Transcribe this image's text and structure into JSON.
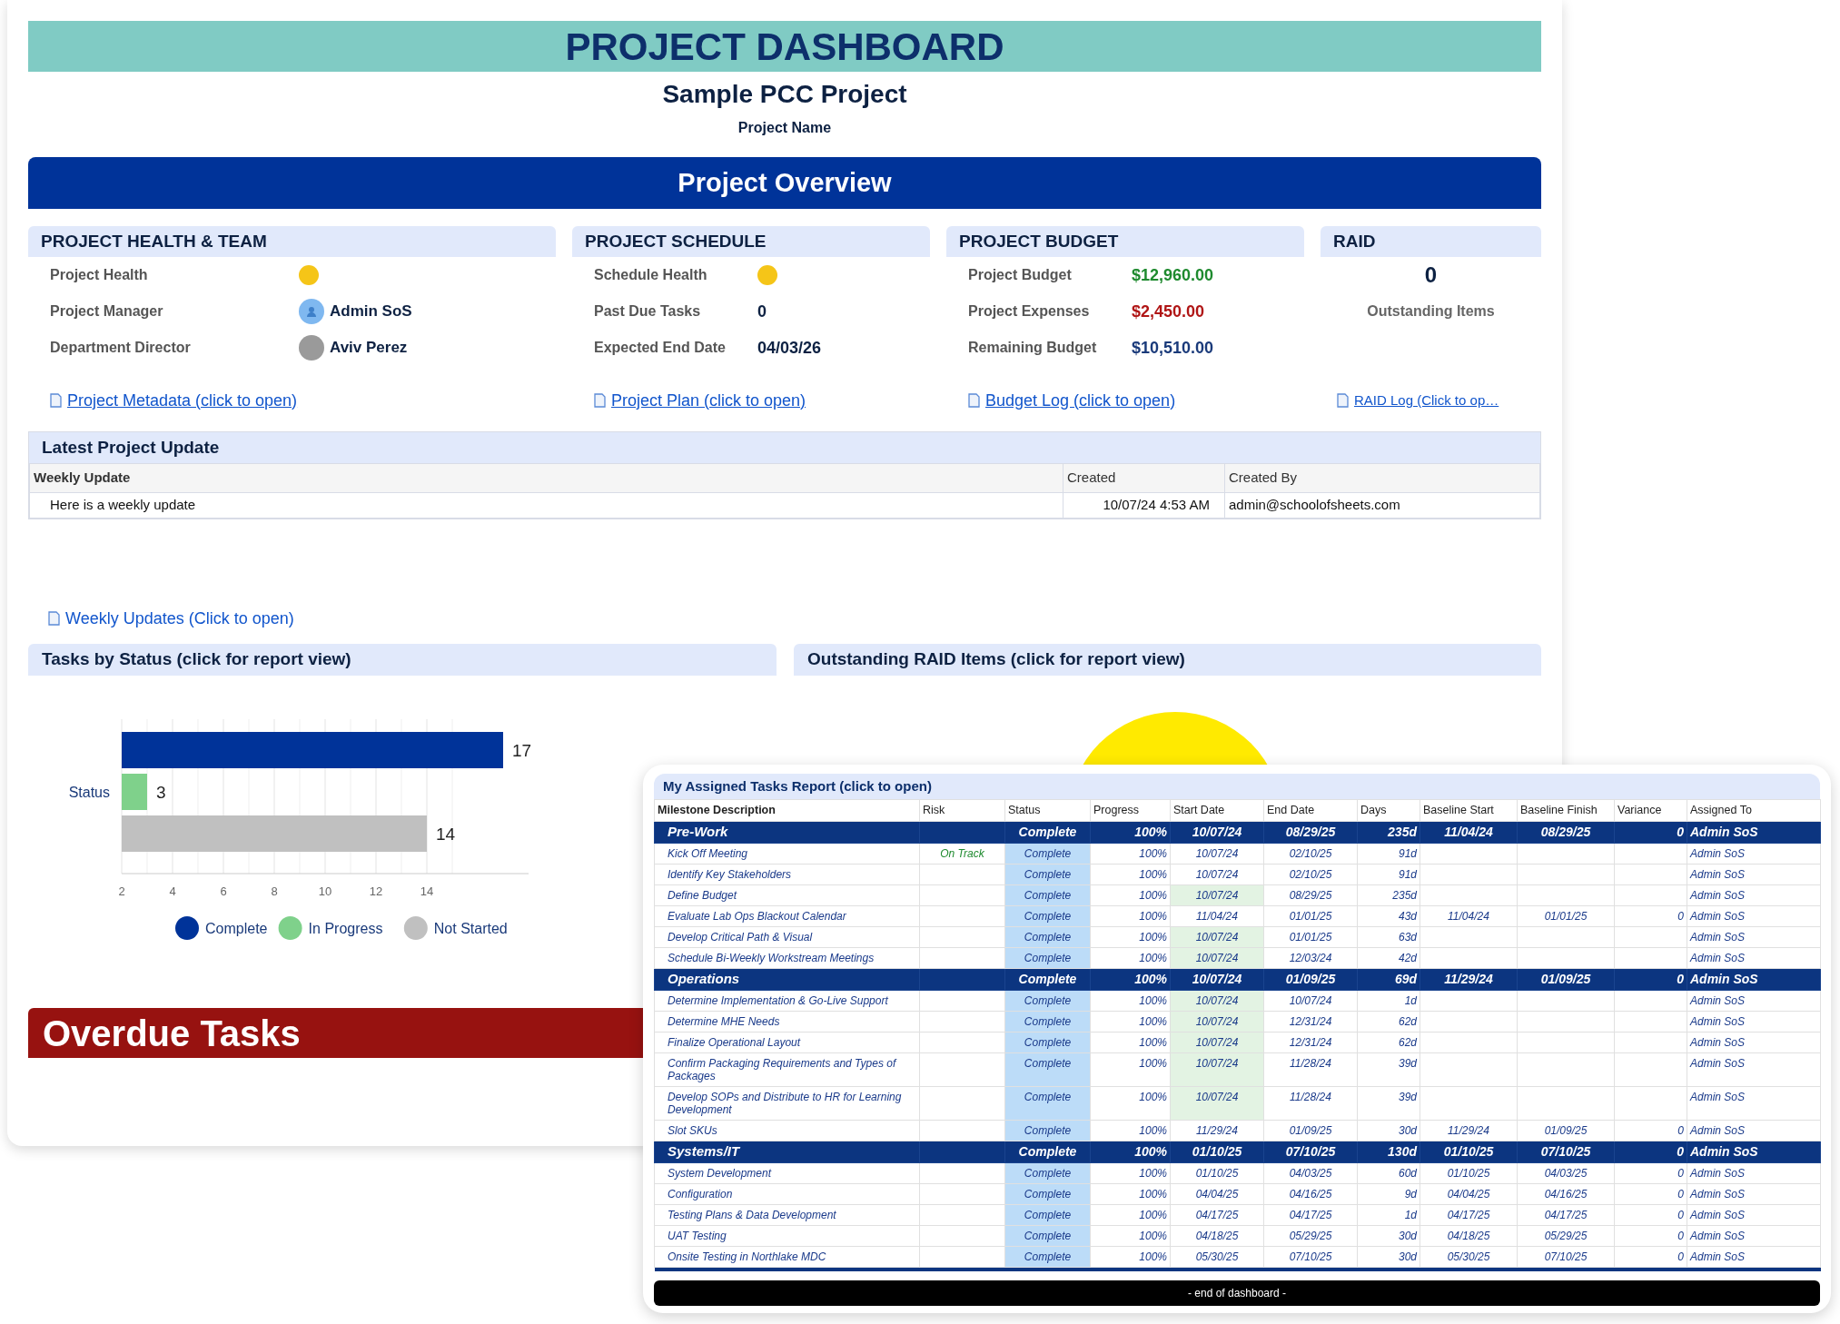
{
  "header": {
    "title": "PROJECT DASHBOARD",
    "project": "Sample PCC Project",
    "project_label": "Project Name"
  },
  "overview_title": "Project Overview",
  "sections": [
    {
      "title": "PROJECT HEALTH & TEAM",
      "rows": [
        {
          "kind": "status",
          "label": "Project Health",
          "color": "#f5c518"
        },
        {
          "kind": "avatar",
          "label": "Project Manager",
          "value": "Admin SoS"
        },
        {
          "kind": "photo",
          "label": "Department Director",
          "value": "Aviv Perez"
        }
      ]
    },
    {
      "title": "PROJECT SCHEDULE",
      "rows": [
        {
          "kind": "status",
          "label": "Schedule Health",
          "color": "#f5c518"
        },
        {
          "kind": "value",
          "label": "Past Due Tasks",
          "value": "0"
        },
        {
          "kind": "value",
          "label": "Expected End Date",
          "value": "04/03/26"
        }
      ]
    },
    {
      "title": "PROJECT BUDGET",
      "rows": [
        {
          "kind": "money",
          "label": "Project Budget",
          "value": "$12,960.00",
          "color": "#1e8a2e"
        },
        {
          "kind": "money",
          "label": "Project Expenses",
          "value": "$2,450.00",
          "color": "#b01515"
        },
        {
          "kind": "money",
          "label": "Remaining Budget",
          "value": "$10,510.00",
          "color": "#1a3a7a"
        }
      ]
    },
    {
      "title": "RAID",
      "rows": [
        {
          "kind": "count",
          "value": "0",
          "label": "Outstanding Items"
        }
      ]
    }
  ],
  "links": [
    {
      "label": "Project Metadata (click to open)",
      "compact": false
    },
    {
      "label": "Project Plan (click to open)",
      "compact": false
    },
    {
      "label": "Budget Log (click to open)",
      "compact": false
    },
    {
      "label": "RAID Log (Click to op…",
      "compact": true
    }
  ],
  "update": {
    "title": "Latest Project Update",
    "columns": [
      "Weekly Update",
      "Created",
      "Created By"
    ],
    "rows": [
      [
        "Here is a weekly update",
        "10/07/24 4:53 AM",
        "admin@schoolofsheets.com"
      ]
    ]
  },
  "weekly_link": "Weekly Updates (Click to open)",
  "tasks_by_status": {
    "title": "Tasks by Status (click for report view)",
    "chart_data": {
      "type": "bar",
      "orientation": "horizontal",
      "categories": [
        "Status"
      ],
      "series": [
        {
          "name": "Complete",
          "color": "#003399",
          "values": [
            17
          ]
        },
        {
          "name": "In Progress",
          "color": "#7fd18b",
          "values": [
            3
          ]
        },
        {
          "name": "Not Started",
          "color": "#c0c0c0",
          "values": [
            14
          ]
        }
      ],
      "xlim": [
        2,
        18
      ],
      "legend": "bottom",
      "xticks": [
        2,
        4,
        6,
        8,
        10,
        12,
        14
      ],
      "grid": true,
      "data_labels": true
    }
  },
  "raid_items": {
    "title": "Outstanding RAID Items (click for report view)"
  },
  "overdue_title": "Overdue Tasks",
  "report": {
    "title": "My Assigned Tasks Report (click to open)",
    "columns": [
      "Milestone Description",
      "Risk",
      "Status",
      "Progress",
      "Start Date",
      "End Date",
      "Days",
      "Baseline Start",
      "Baseline Finish",
      "Variance",
      "Assigned To"
    ],
    "groups": [
      {
        "task": "Pre-Work",
        "status": "Complete",
        "progress": "100%",
        "start": "10/07/24",
        "end": "08/29/25",
        "days": "235d",
        "baseline_start": "11/04/24",
        "baseline_finish": "08/29/25",
        "variance": "0",
        "assigned": "Admin SoS",
        "children": [
          {
            "task": "Kick Off Meeting",
            "risk": "On Track",
            "status": "Complete",
            "progress": "100%",
            "start": "10/07/24",
            "end": "02/10/25",
            "days": "91d",
            "assigned": "Admin SoS",
            "start_highlight": false
          },
          {
            "task": "Identify Key Stakeholders",
            "status": "Complete",
            "progress": "100%",
            "start": "10/07/24",
            "end": "02/10/25",
            "days": "91d",
            "assigned": "Admin SoS",
            "start_highlight": false
          },
          {
            "task": "Define Budget",
            "status": "Complete",
            "progress": "100%",
            "start": "10/07/24",
            "end": "08/29/25",
            "days": "235d",
            "assigned": "Admin SoS",
            "start_highlight": true
          },
          {
            "task": "Evaluate Lab Ops Blackout Calendar",
            "status": "Complete",
            "progress": "100%",
            "start": "11/04/24",
            "end": "01/01/25",
            "days": "43d",
            "baseline_start": "11/04/24",
            "baseline_finish": "01/01/25",
            "variance": "0",
            "assigned": "Admin SoS",
            "start_highlight": false
          },
          {
            "task": "Develop Critical Path & Visual",
            "status": "Complete",
            "progress": "100%",
            "start": "10/07/24",
            "end": "01/01/25",
            "days": "63d",
            "assigned": "Admin SoS",
            "start_highlight": true
          },
          {
            "task": "Schedule Bi-Weekly Workstream Meetings",
            "status": "Complete",
            "progress": "100%",
            "start": "10/07/24",
            "end": "12/03/24",
            "days": "42d",
            "assigned": "Admin SoS",
            "start_highlight": true
          }
        ]
      },
      {
        "task": "Operations",
        "status": "Complete",
        "progress": "100%",
        "start": "10/07/24",
        "end": "01/09/25",
        "days": "69d",
        "baseline_start": "11/29/24",
        "baseline_finish": "01/09/25",
        "variance": "0",
        "assigned": "Admin SoS",
        "children": [
          {
            "task": "Determine Implementation & Go-Live Support",
            "status": "Complete",
            "progress": "100%",
            "start": "10/07/24",
            "end": "10/07/24",
            "days": "1d",
            "assigned": "Admin SoS",
            "start_highlight": true
          },
          {
            "task": "Determine MHE Needs",
            "status": "Complete",
            "progress": "100%",
            "start": "10/07/24",
            "end": "12/31/24",
            "days": "62d",
            "assigned": "Admin SoS",
            "start_highlight": true
          },
          {
            "task": "Finalize Operational Layout",
            "status": "Complete",
            "progress": "100%",
            "start": "10/07/24",
            "end": "12/31/24",
            "days": "62d",
            "assigned": "Admin SoS",
            "start_highlight": true
          },
          {
            "task": "Confirm Packaging Requirements and Types of Packages",
            "status": "Complete",
            "progress": "100%",
            "start": "10/07/24",
            "end": "11/28/24",
            "days": "39d",
            "assigned": "Admin SoS",
            "start_highlight": true
          },
          {
            "task": "Develop SOPs and Distribute to HR for Learning Development",
            "status": "Complete",
            "progress": "100%",
            "start": "10/07/24",
            "end": "11/28/24",
            "days": "39d",
            "assigned": "Admin SoS",
            "start_highlight": true
          },
          {
            "task": "Slot SKUs",
            "status": "Complete",
            "progress": "100%",
            "start": "11/29/24",
            "end": "01/09/25",
            "days": "30d",
            "baseline_start": "11/29/24",
            "baseline_finish": "01/09/25",
            "variance": "0",
            "assigned": "Admin SoS",
            "start_highlight": false
          }
        ]
      },
      {
        "task": "Systems/IT",
        "status": "Complete",
        "progress": "100%",
        "start": "01/10/25",
        "end": "07/10/25",
        "days": "130d",
        "baseline_start": "01/10/25",
        "baseline_finish": "07/10/25",
        "variance": "0",
        "assigned": "Admin SoS",
        "children": [
          {
            "task": "System Development",
            "status": "Complete",
            "progress": "100%",
            "start": "01/10/25",
            "end": "04/03/25",
            "days": "60d",
            "baseline_start": "01/10/25",
            "baseline_finish": "04/03/25",
            "variance": "0",
            "assigned": "Admin SoS",
            "start_highlight": false
          },
          {
            "task": "Configuration",
            "status": "Complete",
            "progress": "100%",
            "start": "04/04/25",
            "end": "04/16/25",
            "days": "9d",
            "baseline_start": "04/04/25",
            "baseline_finish": "04/16/25",
            "variance": "0",
            "assigned": "Admin SoS",
            "start_highlight": false
          },
          {
            "task": "Testing Plans & Data Development",
            "status": "Complete",
            "progress": "100%",
            "start": "04/17/25",
            "end": "04/17/25",
            "days": "1d",
            "baseline_start": "04/17/25",
            "baseline_finish": "04/17/25",
            "variance": "0",
            "assigned": "Admin SoS",
            "start_highlight": false
          },
          {
            "task": "UAT Testing",
            "status": "Complete",
            "progress": "100%",
            "start": "04/18/25",
            "end": "05/29/25",
            "days": "30d",
            "baseline_start": "04/18/25",
            "baseline_finish": "05/29/25",
            "variance": "0",
            "assigned": "Admin SoS",
            "start_highlight": false
          },
          {
            "task": "Onsite Testing in Northlake MDC",
            "status": "Complete",
            "progress": "100%",
            "start": "05/30/25",
            "end": "07/10/25",
            "days": "30d",
            "baseline_start": "05/30/25",
            "baseline_finish": "07/10/25",
            "variance": "0",
            "assigned": "Admin SoS",
            "start_highlight": false
          }
        ]
      }
    ],
    "footer": "- end of dashboard -"
  }
}
